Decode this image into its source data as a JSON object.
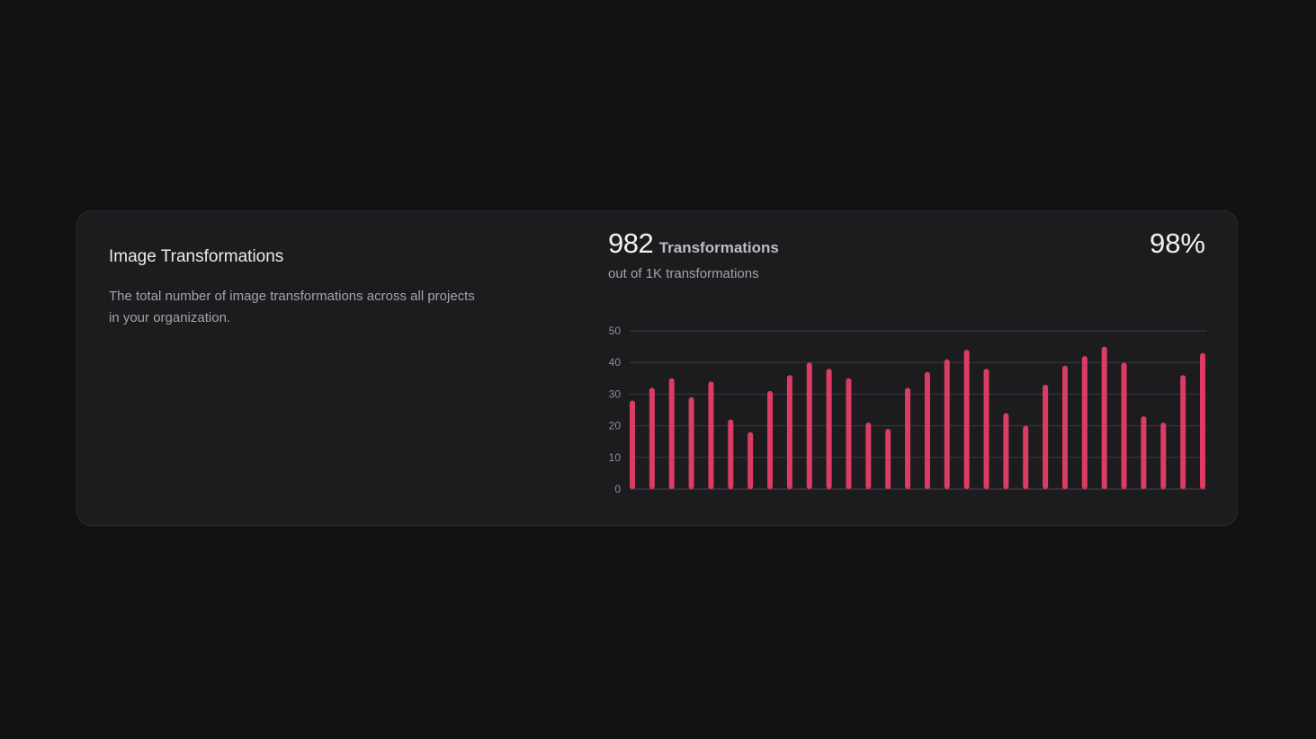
{
  "card": {
    "title": "Image Transformations",
    "description": "The total number of image transformations across all projects in your organization.",
    "metric_value": "982",
    "metric_unit": "Transformations",
    "metric_sub": "out of 1K transformations",
    "percent": "98%"
  },
  "colors": {
    "bar": "#dc3c63",
    "grid": "#3a3a3f",
    "tick": "#8e8e94",
    "card": "#1c1c1f",
    "page": "#121214"
  },
  "chart_data": {
    "type": "bar",
    "ylim": [
      0,
      50
    ],
    "yticks": [
      "0",
      "10",
      "20",
      "30",
      "40",
      "50"
    ],
    "grid": true,
    "values": [
      28,
      32,
      35,
      29,
      34,
      22,
      18,
      31,
      36,
      40,
      38,
      35,
      21,
      19,
      32,
      37,
      41,
      44,
      38,
      24,
      20,
      33,
      39,
      42,
      45,
      40,
      23,
      21,
      36,
      43
    ]
  }
}
